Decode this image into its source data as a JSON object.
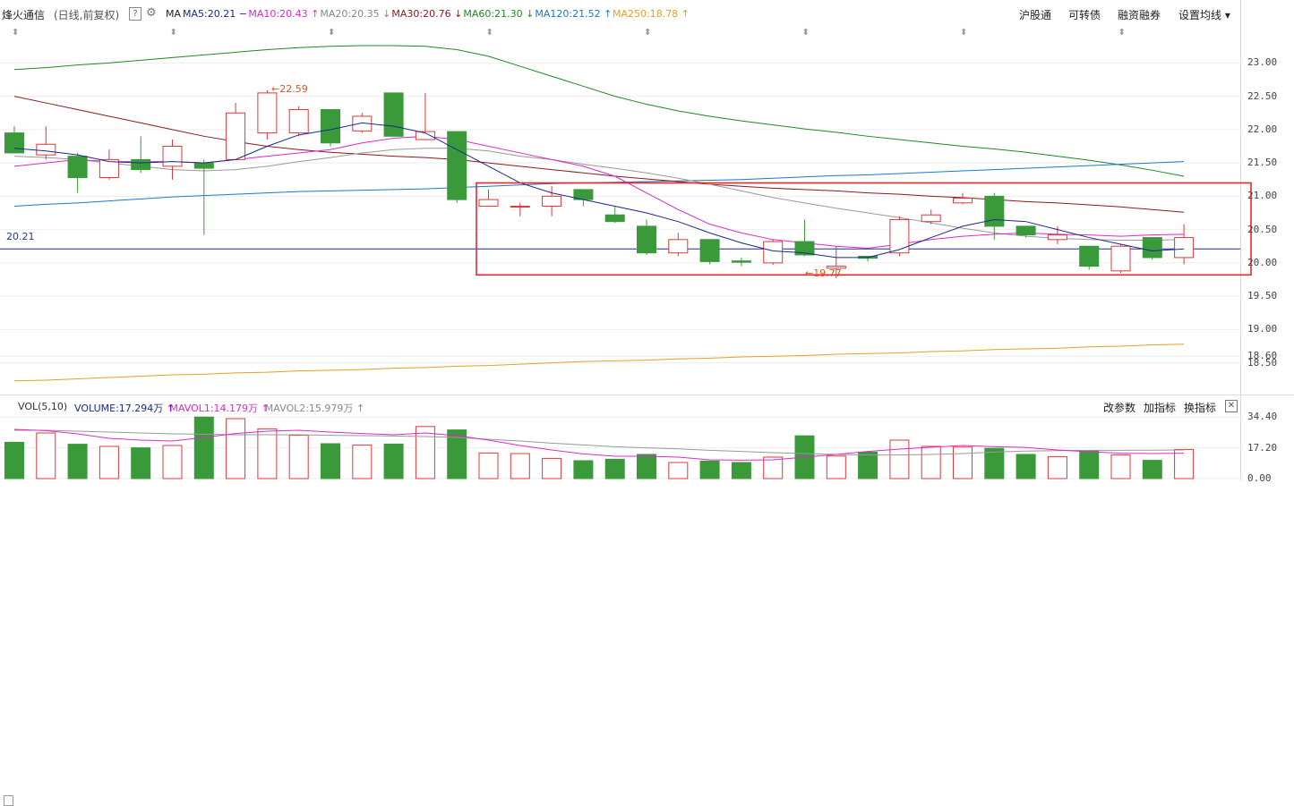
{
  "header": {
    "stock_name": "烽火通信",
    "period": "(日线,前复权)",
    "help_icon": "question-icon",
    "settings_icon": "gear-icon",
    "ma_label": "MA",
    "ma_items": [
      {
        "text": "MA5:20.21",
        "arrow": "−",
        "color": "#1a2a8a"
      },
      {
        "text": "MA10:20.43",
        "arrow": "↑",
        "color": "#e028c8"
      },
      {
        "text": "MA20:20.35",
        "arrow": "↓",
        "color": "#888888"
      },
      {
        "text": "MA30:20.76",
        "arrow": "↓",
        "color": "#8b1a1a"
      },
      {
        "text": "MA60:21.30",
        "arrow": "↓",
        "color": "#1e8a1e"
      },
      {
        "text": "MA120:21.52",
        "arrow": "↑",
        "color": "#1a7ac8"
      },
      {
        "text": "MA250:18.78",
        "arrow": "↑",
        "color": "#e8a020"
      }
    ],
    "right_buttons": [
      "沪股通",
      "可转债",
      "融资融券",
      "设置均线"
    ]
  },
  "volume_header": {
    "label": "VOL(5,10)",
    "items": [
      {
        "text": "VOLUME:17.294万",
        "arrow": "↑",
        "color": "#1a2a8a"
      },
      {
        "text": "MAVOL1:14.179万",
        "arrow": "↑",
        "color": "#e028c8"
      },
      {
        "text": "MAVOL2:15.979万",
        "arrow": "↑",
        "color": "#888888"
      }
    ],
    "right_buttons": [
      "改参数",
      "加指标",
      "换指标"
    ]
  },
  "colors": {
    "up": "#e0383a",
    "down": "#3a9a3a",
    "ma5": "#1a2a8a",
    "ma10": "#e028c8",
    "ma20": "#999999",
    "ma30": "#8b1a1a",
    "ma60": "#1e8a1e",
    "ma120": "#1a7ac8",
    "ma250": "#e8a020",
    "highlight": "#e8282a"
  },
  "chart_data": {
    "type": "candlestick",
    "price_ylim": [
      18.2,
      23.3
    ],
    "price_ticks": [
      "23.00",
      "22.50",
      "22.00",
      "21.50",
      "21.00",
      "20.50",
      "20.00",
      "19.50",
      "19.00",
      "18.60",
      "18.50"
    ],
    "price_tick_values": [
      23.0,
      22.5,
      22.0,
      21.5,
      21.0,
      20.5,
      20.0,
      19.5,
      19.0,
      18.6,
      18.5
    ],
    "last_price_label": "20.21",
    "last_price": 20.21,
    "high_annotation": "22.59",
    "low_annotation": "19.77",
    "volume_ylim": [
      0,
      36
    ],
    "volume_ticks": [
      "34.40",
      "17.20",
      "0.00"
    ],
    "volume_tick_values": [
      34.4,
      17.2,
      0
    ],
    "candles": [
      {
        "o": 21.95,
        "c": 21.65,
        "h": 22.05,
        "l": 21.65,
        "v": 20.3
      },
      {
        "o": 21.62,
        "c": 21.78,
        "h": 22.05,
        "l": 21.55,
        "v": 25.5
      },
      {
        "o": 21.6,
        "c": 21.28,
        "h": 21.65,
        "l": 21.05,
        "v": 19.2
      },
      {
        "o": 21.28,
        "c": 21.55,
        "h": 21.7,
        "l": 21.25,
        "v": 18.0
      },
      {
        "o": 21.55,
        "c": 21.4,
        "h": 21.9,
        "l": 21.35,
        "v": 17.2
      },
      {
        "o": 21.45,
        "c": 21.75,
        "h": 21.85,
        "l": 21.25,
        "v": 18.5
      },
      {
        "o": 21.5,
        "c": 21.42,
        "h": 21.55,
        "l": 20.42,
        "v": 34.4
      },
      {
        "o": 21.55,
        "c": 22.25,
        "h": 22.4,
        "l": 21.55,
        "v": 33.5
      },
      {
        "o": 21.95,
        "c": 22.55,
        "h": 22.59,
        "l": 21.85,
        "v": 27.8
      },
      {
        "o": 21.95,
        "c": 22.3,
        "h": 22.35,
        "l": 21.9,
        "v": 24.2
      },
      {
        "o": 22.3,
        "c": 21.8,
        "h": 22.3,
        "l": 21.75,
        "v": 19.5
      },
      {
        "o": 21.98,
        "c": 22.2,
        "h": 22.25,
        "l": 21.95,
        "v": 18.7
      },
      {
        "o": 22.55,
        "c": 21.9,
        "h": 22.55,
        "l": 21.9,
        "v": 19.3
      },
      {
        "o": 21.85,
        "c": 21.97,
        "h": 22.55,
        "l": 21.85,
        "v": 29.1
      },
      {
        "o": 21.97,
        "c": 20.95,
        "h": 21.97,
        "l": 20.9,
        "v": 27.2
      },
      {
        "o": 20.85,
        "c": 20.95,
        "h": 21.1,
        "l": 20.85,
        "v": 14.3
      },
      {
        "o": 20.85,
        "c": 20.85,
        "h": 20.9,
        "l": 20.7,
        "v": 14.0
      },
      {
        "o": 20.85,
        "c": 21.0,
        "h": 21.15,
        "l": 20.7,
        "v": 11.3
      },
      {
        "o": 21.1,
        "c": 20.95,
        "h": 21.1,
        "l": 20.85,
        "v": 10.0
      },
      {
        "o": 20.72,
        "c": 20.62,
        "h": 20.85,
        "l": 20.6,
        "v": 10.8
      },
      {
        "o": 20.55,
        "c": 20.15,
        "h": 20.65,
        "l": 20.12,
        "v": 13.5
      },
      {
        "o": 20.15,
        "c": 20.35,
        "h": 20.45,
        "l": 20.1,
        "v": 9.0
      },
      {
        "o": 20.35,
        "c": 20.02,
        "h": 20.35,
        "l": 19.98,
        "v": 9.8
      },
      {
        "o": 20.03,
        "c": 20.01,
        "h": 20.08,
        "l": 19.95,
        "v": 9.0
      },
      {
        "o": 20.0,
        "c": 20.32,
        "h": 20.35,
        "l": 19.97,
        "v": 12.0
      },
      {
        "o": 20.32,
        "c": 20.12,
        "h": 20.65,
        "l": 20.1,
        "v": 23.9
      },
      {
        "o": 19.92,
        "c": 19.95,
        "h": 20.25,
        "l": 19.77,
        "v": 12.6
      },
      {
        "o": 20.1,
        "c": 20.07,
        "h": 20.1,
        "l": 20.02,
        "v": 14.8
      },
      {
        "o": 20.15,
        "c": 20.65,
        "h": 20.7,
        "l": 20.1,
        "v": 21.5
      },
      {
        "o": 20.62,
        "c": 20.72,
        "h": 20.8,
        "l": 20.58,
        "v": 18.0
      },
      {
        "o": 20.9,
        "c": 20.97,
        "h": 21.05,
        "l": 20.88,
        "v": 17.6
      },
      {
        "o": 21.0,
        "c": 20.55,
        "h": 21.05,
        "l": 20.35,
        "v": 16.9
      },
      {
        "o": 20.55,
        "c": 20.42,
        "h": 20.55,
        "l": 20.38,
        "v": 13.5
      },
      {
        "o": 20.35,
        "c": 20.42,
        "h": 20.55,
        "l": 20.28,
        "v": 12.3
      },
      {
        "o": 20.25,
        "c": 19.95,
        "h": 20.25,
        "l": 19.9,
        "v": 15.5
      },
      {
        "o": 19.88,
        "c": 20.25,
        "h": 20.28,
        "l": 19.85,
        "v": 13.2
      },
      {
        "o": 20.38,
        "c": 20.08,
        "h": 20.38,
        "l": 20.05,
        "v": 10.2
      },
      {
        "o": 20.08,
        "c": 20.38,
        "h": 20.58,
        "l": 19.98,
        "v": 16.3
      }
    ],
    "ma5": [
      21.72,
      21.68,
      21.62,
      21.52,
      21.5,
      21.52,
      21.5,
      21.55,
      21.75,
      21.92,
      22.0,
      22.1,
      22.05,
      21.95,
      21.7,
      21.45,
      21.2,
      21.05,
      20.95,
      20.85,
      20.75,
      20.62,
      20.45,
      20.3,
      20.18,
      20.15,
      20.08,
      20.08,
      20.2,
      20.38,
      20.55,
      20.65,
      20.62,
      20.5,
      20.38,
      20.28,
      20.18,
      20.21
    ],
    "ma10": [
      21.45,
      21.5,
      21.55,
      21.52,
      21.52,
      21.52,
      21.5,
      21.55,
      21.6,
      21.65,
      21.7,
      21.8,
      21.87,
      21.9,
      21.85,
      21.75,
      21.65,
      21.55,
      21.45,
      21.3,
      21.05,
      20.8,
      20.58,
      20.45,
      20.35,
      20.3,
      20.25,
      20.22,
      20.28,
      20.35,
      20.4,
      20.43,
      20.45,
      20.43,
      20.42,
      20.4,
      20.42,
      20.43
    ],
    "ma20": [
      21.6,
      21.58,
      21.55,
      21.5,
      21.45,
      21.4,
      21.38,
      21.4,
      21.45,
      21.52,
      21.58,
      21.65,
      21.7,
      21.72,
      21.72,
      21.68,
      21.6,
      21.55,
      21.48,
      21.42,
      21.35,
      21.27,
      21.18,
      21.08,
      20.98,
      20.9,
      20.82,
      20.75,
      20.68,
      20.6,
      20.52,
      20.45,
      20.4,
      20.37,
      20.35,
      20.34,
      20.34,
      20.35
    ],
    "ma30": [
      22.5,
      22.4,
      22.3,
      22.2,
      22.1,
      22.0,
      21.9,
      21.82,
      21.75,
      21.7,
      21.66,
      21.63,
      21.6,
      21.58,
      21.55,
      21.5,
      21.45,
      21.4,
      21.35,
      21.3,
      21.26,
      21.22,
      21.18,
      21.15,
      21.12,
      21.1,
      21.08,
      21.05,
      21.03,
      21.0,
      20.98,
      20.95,
      20.92,
      20.9,
      20.87,
      20.84,
      20.8,
      20.76
    ],
    "ma60": [
      22.9,
      22.93,
      22.97,
      23.0,
      23.04,
      23.08,
      23.12,
      23.16,
      23.2,
      23.23,
      23.25,
      23.26,
      23.26,
      23.25,
      23.2,
      23.1,
      22.95,
      22.8,
      22.65,
      22.5,
      22.38,
      22.28,
      22.2,
      22.13,
      22.07,
      22.01,
      21.96,
      21.9,
      21.85,
      21.8,
      21.75,
      21.71,
      21.66,
      21.6,
      21.54,
      21.47,
      21.39,
      21.3
    ],
    "ma120": [
      20.85,
      20.88,
      20.9,
      20.93,
      20.96,
      20.99,
      21.01,
      21.03,
      21.05,
      21.07,
      21.08,
      21.09,
      21.1,
      21.11,
      21.13,
      21.15,
      21.17,
      21.19,
      21.2,
      21.21,
      21.22,
      21.23,
      21.24,
      21.25,
      21.27,
      21.29,
      21.31,
      21.32,
      21.34,
      21.36,
      21.38,
      21.4,
      21.42,
      21.44,
      21.46,
      21.48,
      21.5,
      21.52
    ],
    "ma250": [
      18.23,
      18.24,
      18.26,
      18.28,
      18.3,
      18.32,
      18.33,
      18.35,
      18.36,
      18.38,
      18.39,
      18.4,
      18.42,
      18.43,
      18.45,
      18.46,
      18.48,
      18.5,
      18.52,
      18.53,
      18.54,
      18.56,
      18.57,
      18.59,
      18.6,
      18.61,
      18.63,
      18.64,
      18.65,
      18.67,
      18.68,
      18.7,
      18.71,
      18.72,
      18.74,
      18.75,
      18.77,
      18.78
    ],
    "mavol1": [
      27.5,
      26.8,
      25.0,
      22.5,
      21.5,
      21.0,
      23.0,
      25.2,
      26.5,
      27.0,
      26.0,
      25.2,
      24.5,
      25.5,
      24.0,
      21.5,
      18.5,
      16.0,
      13.8,
      12.5,
      12.5,
      12.0,
      10.5,
      10.3,
      10.5,
      12.0,
      13.5,
      15.2,
      16.5,
      17.5,
      18.5,
      17.8,
      17.4,
      16.0,
      15.0,
      14.2,
      14.0,
      14.18
    ],
    "mavol2": [
      27.0,
      27.0,
      26.5,
      26.0,
      25.5,
      25.0,
      24.8,
      24.5,
      24.5,
      24.5,
      24.2,
      24.0,
      23.8,
      23.5,
      23.0,
      22.0,
      21.0,
      19.8,
      18.8,
      17.8,
      17.2,
      16.6,
      15.8,
      15.2,
      14.5,
      14.0,
      13.5,
      13.2,
      13.2,
      13.5,
      14.0,
      14.8,
      15.4,
      15.6,
      15.8,
      15.8,
      15.9,
      15.98
    ]
  }
}
